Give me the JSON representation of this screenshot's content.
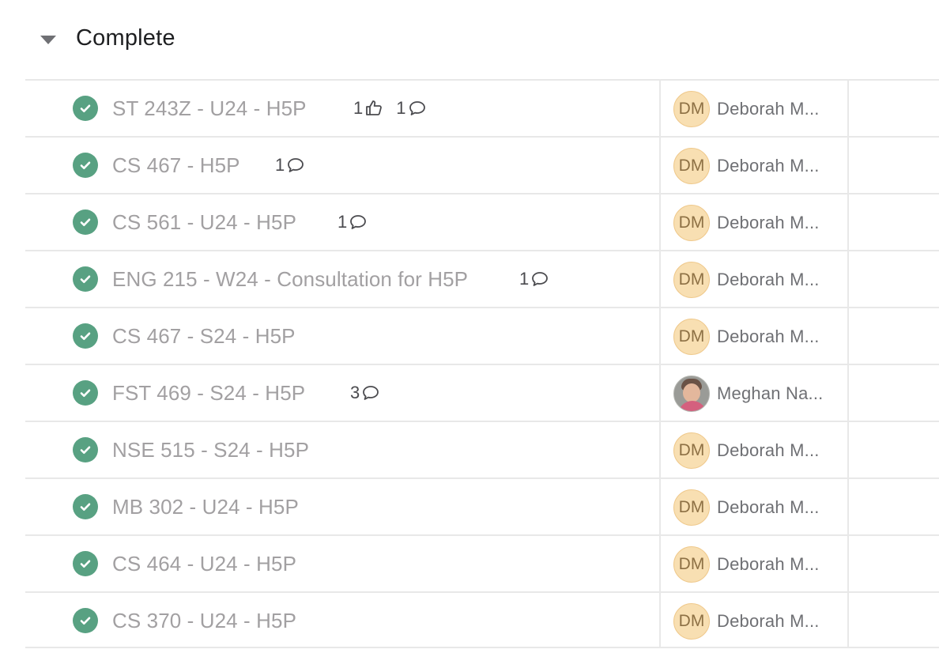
{
  "section": {
    "title": "Complete",
    "collapse_icon": "caret-down-icon"
  },
  "colors": {
    "check_green": "#58a182",
    "avatar_bg": "#f8dfb2",
    "task_text": "#a2a0a2"
  },
  "tasks": [
    {
      "name": "ST 243Z - U24 - H5P",
      "likes": "1",
      "comments": "1",
      "assignee_initials": "DM",
      "assignee": "Deborah M..."
    },
    {
      "name": "CS 467 - H5P",
      "likes": "",
      "comments": "1",
      "assignee_initials": "DM",
      "assignee": "Deborah M..."
    },
    {
      "name": "CS 561 - U24 - H5P",
      "likes": "",
      "comments": "1",
      "assignee_initials": "DM",
      "assignee": "Deborah M..."
    },
    {
      "name": "ENG 215 - W24 - Consultation for H5P",
      "likes": "",
      "comments": "1",
      "assignee_initials": "DM",
      "assignee": "Deborah M..."
    },
    {
      "name": "CS 467 - S24 - H5P",
      "likes": "",
      "comments": "",
      "assignee_initials": "DM",
      "assignee": "Deborah M..."
    },
    {
      "name": "FST 469 - S24 - H5P",
      "likes": "",
      "comments": "3",
      "assignee_initials": "",
      "assignee": "Meghan Na..."
    },
    {
      "name": "NSE 515 - S24 - H5P",
      "likes": "",
      "comments": "",
      "assignee_initials": "DM",
      "assignee": "Deborah M..."
    },
    {
      "name": "MB 302 - U24 - H5P",
      "likes": "",
      "comments": "",
      "assignee_initials": "DM",
      "assignee": "Deborah M..."
    },
    {
      "name": "CS 464 - U24 - H5P",
      "likes": "",
      "comments": "",
      "assignee_initials": "DM",
      "assignee": "Deborah M..."
    },
    {
      "name": "CS 370 - U24 - H5P",
      "likes": "",
      "comments": "",
      "assignee_initials": "DM",
      "assignee": "Deborah M..."
    }
  ]
}
